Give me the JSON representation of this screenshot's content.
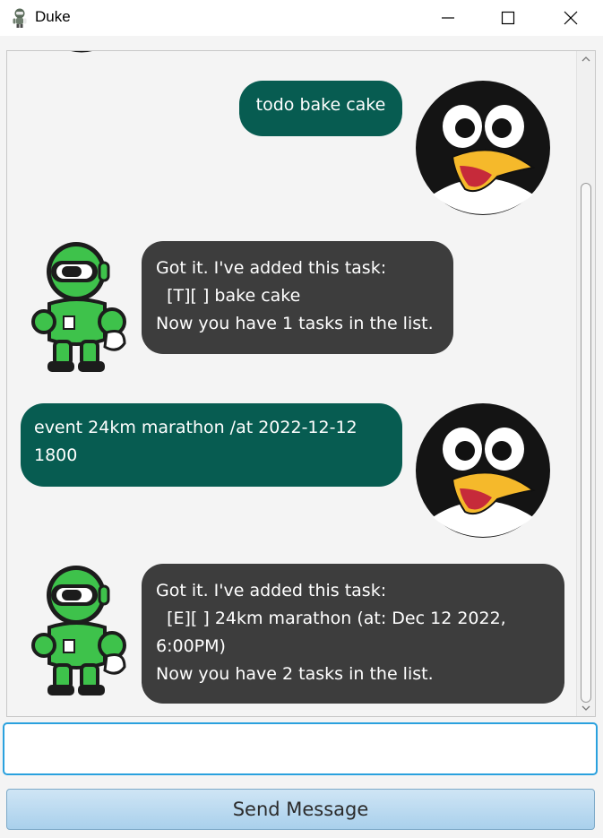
{
  "window": {
    "title": "Duke"
  },
  "conversation": [
    {
      "speaker": "user",
      "text": "todo bake cake"
    },
    {
      "speaker": "duke",
      "text": "Got it. I've added this task:\n  [T][ ] bake cake\nNow you have 1 tasks in the list."
    },
    {
      "speaker": "user",
      "text": "event 24km marathon /at 2022-12-12\n1800"
    },
    {
      "speaker": "duke",
      "text": "Got it. I've added this task:\n  [E][ ] 24km marathon (at: Dec 12 2022,\n6:00PM)\nNow you have 2 tasks in the list."
    }
  ],
  "input": {
    "value": "",
    "placeholder": ""
  },
  "send_button": {
    "label": "Send Message"
  },
  "colors": {
    "user_bubble": "#075c51",
    "duke_bubble": "#3d3d3d",
    "input_focus_border": "#2aa1de",
    "robot_green": "#3ec24b"
  },
  "icons": {
    "app": "robot-icon",
    "user_avatar": "penguin-avatar",
    "duke_avatar": "green-robot-avatar"
  }
}
